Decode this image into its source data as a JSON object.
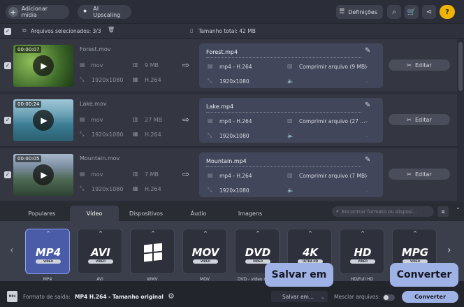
{
  "toolbar": {
    "add_media": "Adicionar mídia",
    "ai_upscaling": "AI Upscaling",
    "settings": "Definições"
  },
  "selection": {
    "selected": "Arquivos selecionados: 3/3",
    "total": "Tamanho total: 42 MB"
  },
  "files": [
    {
      "duration": "00:00:07",
      "name": "Forest.mov",
      "ext": "mov",
      "size": "9 MB",
      "res": "1920x1080",
      "codec": "H.264",
      "out_name": "Forest.mp4",
      "out_format": "mp4 - H.264",
      "compress": "Comprimir arquivo (9 MB)",
      "out_res": "1920x1080",
      "edit": "Editar"
    },
    {
      "duration": "00:00:24",
      "name": "Lake.mov",
      "ext": "mov",
      "size": "27 MB",
      "res": "1920x1080",
      "codec": "H.264",
      "out_name": "Lake.mp4",
      "out_format": "mp4 - H.264",
      "compress": "Comprimir arquivo (27 ...",
      "out_res": "1920x1080",
      "edit": "Editar"
    },
    {
      "duration": "00:00:05",
      "name": "Mountain.mov",
      "ext": "mov",
      "size": "7 MB",
      "res": "1920x1080",
      "codec": "H.264",
      "out_name": "Mountain.mp4",
      "out_format": "mp4 - H.264",
      "compress": "Comprimir arquivo (7 MB)",
      "out_res": "1920x1080",
      "edit": "Editar"
    }
  ],
  "tabs": [
    "Populares",
    "Vídeo",
    "Dispositivos",
    "Áudio",
    "Imagens"
  ],
  "search_placeholder": "Encontrar formato ou disposi...",
  "formats": [
    {
      "logo": "MP4",
      "sub": "VIDEO",
      "label": "MP4"
    },
    {
      "logo": "AVI",
      "sub": "VIDEO",
      "label": "AVI"
    },
    {
      "logo": "",
      "sub": "",
      "label": "WMV"
    },
    {
      "logo": "MOV",
      "sub": "VIDEO",
      "label": "MOV"
    },
    {
      "logo": "DVD",
      "sub": "VIDEO",
      "label": "DVD - vídeo com..."
    },
    {
      "logo": "4K",
      "sub": "ULTRA HD",
      "label": ""
    },
    {
      "logo": "HD",
      "sub": "VIDEO",
      "label": "HD/Full HD"
    },
    {
      "logo": "MPG",
      "sub": "VIDEO",
      "label": ""
    }
  ],
  "tooltips": {
    "save": "Salvar em",
    "convert": "Converter"
  },
  "footer": {
    "format_label": "Formato de saída:",
    "format_value": "MP4 H.264 - Tamanho original",
    "save_to": "Salvar em...",
    "merge": "Mesclar arquivos:",
    "convert": "Converter"
  },
  "colors": {
    "accent": "#4a5ba8",
    "convert_button": "#9fb2e6"
  }
}
